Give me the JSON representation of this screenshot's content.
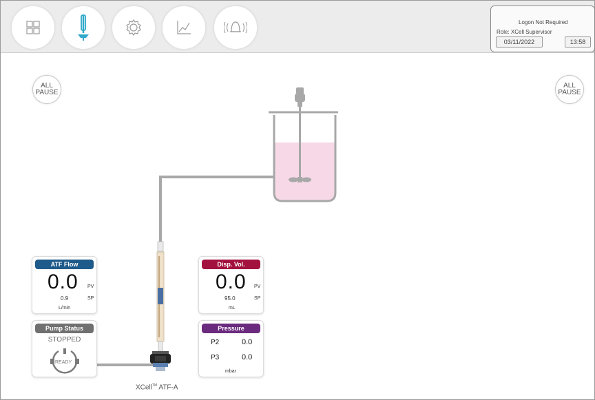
{
  "nav": {
    "buttons": [
      {
        "name": "dashboard",
        "icon": "grid-icon"
      },
      {
        "name": "process-view",
        "icon": "bioreactor-icon",
        "active": true
      },
      {
        "name": "settings",
        "icon": "gear-icon"
      },
      {
        "name": "trends",
        "icon": "chart-icon"
      },
      {
        "name": "alarms",
        "icon": "bell-icon"
      }
    ]
  },
  "logon": {
    "status": "Logon Not Required",
    "role": "Role: XCell Supervisor",
    "date": "03/11/2022",
    "time": "13:58"
  },
  "all_pause": {
    "label": "ALL\nPAUSE"
  },
  "atf_flow": {
    "title": "ATF Flow",
    "pv": "0.0",
    "sp": "0.9",
    "unit": "L/min",
    "pv_label": "PV",
    "sp_label": "SP",
    "color": "#1e5a8a"
  },
  "disp_vol": {
    "title": "Disp. Vol.",
    "pv": "0.0",
    "sp": "95.0",
    "unit": "mL",
    "pv_label": "PV",
    "sp_label": "SP",
    "color": "#a3123e"
  },
  "pump_status": {
    "title": "Pump Status",
    "state": "STOPPED",
    "ring_label": "READY",
    "color": "#707070"
  },
  "pressure": {
    "title": "Pressure",
    "rows": [
      {
        "label": "P2",
        "value": "0.0"
      },
      {
        "label": "P3",
        "value": "0.0"
      }
    ],
    "unit": "mbar",
    "color": "#6a2a7e"
  },
  "device": {
    "name": "XCell",
    "tm": "TM",
    "model": "ATF-A"
  },
  "colors": {
    "liquid": "#f6d8e6",
    "tubing": "#a8a8a8",
    "accent": "#2fa8c9"
  }
}
